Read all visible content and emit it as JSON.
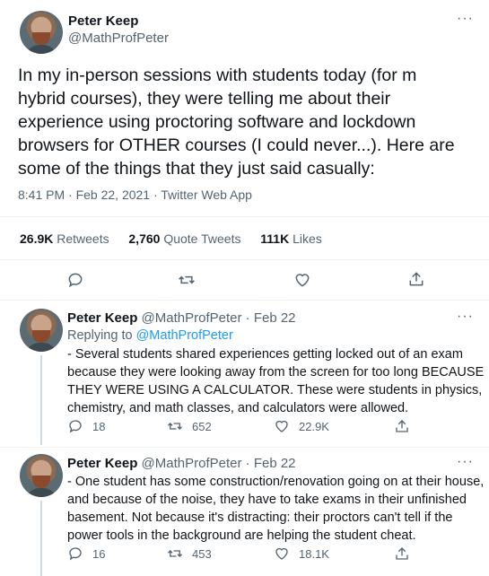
{
  "main_tweet": {
    "author_name": "Peter Keep",
    "author_handle": "@MathProfPeter",
    "text_lines": [
      "In my in-person sessions with students today (for m",
      "hybrid courses), they were telling me about their",
      "experience using proctoring software and lockdown",
      "browsers for OTHER courses (I could never...). Here are",
      "some of the things that they just said casually:"
    ],
    "timestamp": "8:41 PM · Feb 22, 2021 · Twitter Web App",
    "stats": {
      "retweets_num": "26.9K",
      "retweets_label": "Retweets",
      "quotes_num": "2,760",
      "quotes_label": "Quote Tweets",
      "likes_num": "111K",
      "likes_label": "Likes"
    }
  },
  "replies": [
    {
      "author_name": "Peter Keep",
      "author_handle": "@MathProfPeter",
      "date": "· Feb 22",
      "replying_to_label": "Replying to",
      "replying_to_handle": "@MathProfPeter",
      "text_lines": [
        "- Several students shared experiences getting locked out of an exam",
        "because they were looking away from the screen for too long BECAUSE",
        "THEY WERE USING A CALCULATOR. These were students in physics,",
        "chemistry, and math classes, and calculators were allowed."
      ],
      "reply_count": "18",
      "retweet_count": "652",
      "like_count": "22.9K"
    },
    {
      "author_name": "Peter Keep",
      "author_handle": "@MathProfPeter",
      "date": "· Feb 22",
      "text_lines": [
        "- One student has some construction/renovation going on at their house,",
        "and because of the noise, they have to take exams in their unfinished",
        "basement. Not because it's distracting: their proctors can't tell if the",
        "power tools in the background are helping the student cheat."
      ],
      "reply_count": "16",
      "retweet_count": "453",
      "like_count": "18.1K"
    }
  ],
  "more_icon": "···",
  "colors": {
    "link": "#1d9bf0",
    "muted": "#536471",
    "divider": "#eff3f4"
  },
  "icons": [
    "reply-icon",
    "retweet-icon",
    "like-icon",
    "share-icon",
    "more-icon"
  ]
}
